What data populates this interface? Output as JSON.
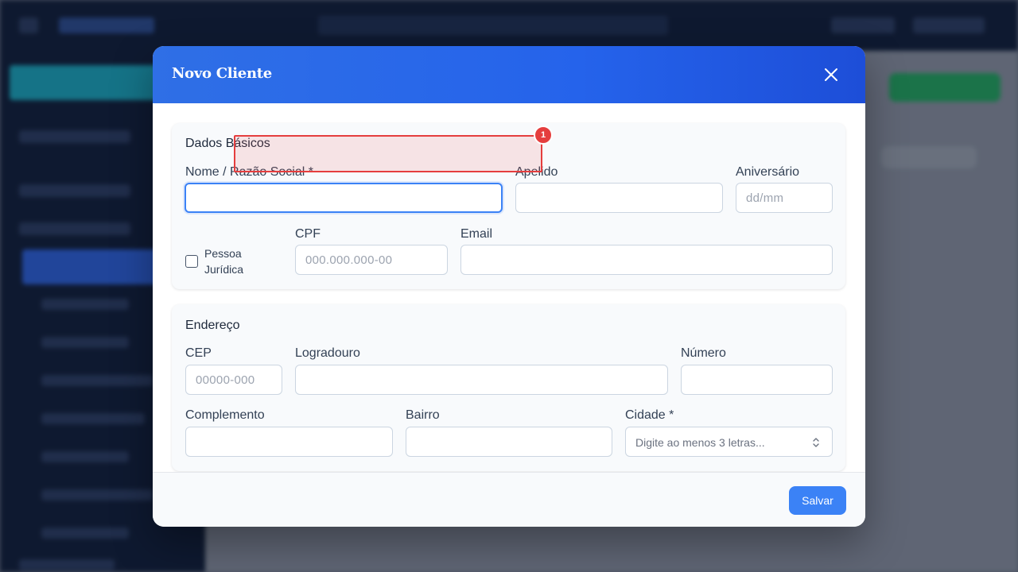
{
  "modal": {
    "title": "Novo Cliente",
    "close_icon": "close-icon"
  },
  "dados_basicos": {
    "section_title": "Dados Básicos",
    "nome_label": "Nome / Razão Social *",
    "nome_value": "",
    "apelido_label": "Apelido",
    "apelido_value": "",
    "aniversario_label": "Aniversário",
    "aniversario_placeholder": "dd/mm",
    "pessoa_juridica_label": "Pessoa Jurídica",
    "pessoa_juridica_checked": false,
    "cpf_label": "CPF",
    "cpf_placeholder": "000.000.000-00",
    "email_label": "Email",
    "email_value": ""
  },
  "endereco": {
    "section_title": "Endereço",
    "cep_label": "CEP",
    "cep_placeholder": "00000-000",
    "logradouro_label": "Logradouro",
    "numero_label": "Número",
    "complemento_label": "Complemento",
    "bairro_label": "Bairro",
    "cidade_label": "Cidade *",
    "cidade_placeholder": "Digite ao menos 3 letras...",
    "cidade_icon": "chevron-up-down-icon"
  },
  "footer": {
    "save_label": "Salvar"
  },
  "annotation": {
    "badge": "1"
  },
  "colors": {
    "header_blue": "#2563eb",
    "primary_button": "#3b82f6",
    "focus_ring": "#3b82f6",
    "annotation_red": "#e53e3e"
  }
}
